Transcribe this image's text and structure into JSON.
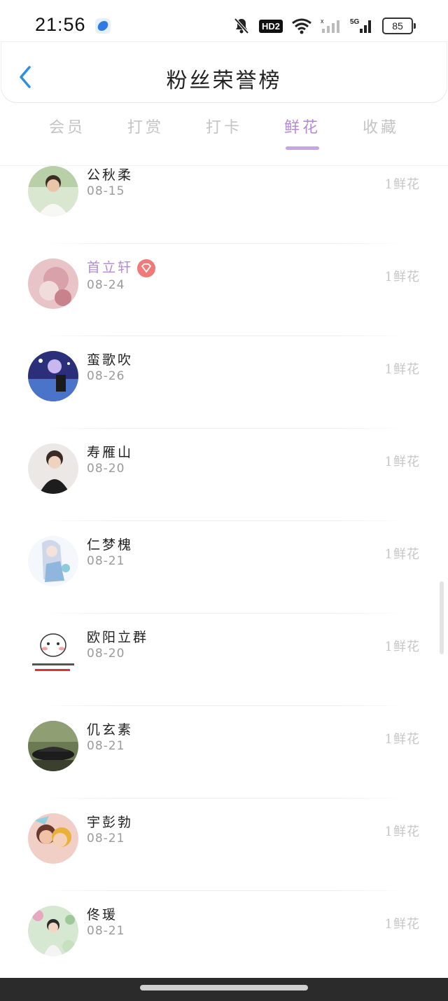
{
  "status_bar": {
    "time": "21:56",
    "hd_label": "HD2",
    "network_label": "5G",
    "battery": "85"
  },
  "header": {
    "title": "粉丝荣誉榜",
    "back_icon": "chevron-left-icon"
  },
  "tabs": [
    {
      "label": "会员",
      "active": false
    },
    {
      "label": "打赏",
      "active": false
    },
    {
      "label": "打卡",
      "active": false
    },
    {
      "label": "鲜花",
      "active": true
    },
    {
      "label": "收藏",
      "active": false
    }
  ],
  "colors": {
    "accent": "#b48ad6",
    "back_arrow": "#2f8fe0",
    "vip_badge": "#f07a7a"
  },
  "fans": [
    {
      "name": "公秋柔",
      "date": "08-15",
      "count": "1鲜花",
      "vip": false
    },
    {
      "name": "首立轩",
      "date": "08-24",
      "count": "1鲜花",
      "vip": true
    },
    {
      "name": "蛮歌吹",
      "date": "08-26",
      "count": "1鲜花",
      "vip": false
    },
    {
      "name": "寿雁山",
      "date": "08-20",
      "count": "1鲜花",
      "vip": false
    },
    {
      "name": "仁梦槐",
      "date": "08-21",
      "count": "1鲜花",
      "vip": false
    },
    {
      "name": "欧阳立群",
      "date": "08-20",
      "count": "1鲜花",
      "vip": false
    },
    {
      "name": "仉玄素",
      "date": "08-21",
      "count": "1鲜花",
      "vip": false
    },
    {
      "name": "宇彭勃",
      "date": "08-21",
      "count": "1鲜花",
      "vip": false
    },
    {
      "name": "佟瑗",
      "date": "08-21",
      "count": "1鲜花",
      "vip": false
    }
  ]
}
